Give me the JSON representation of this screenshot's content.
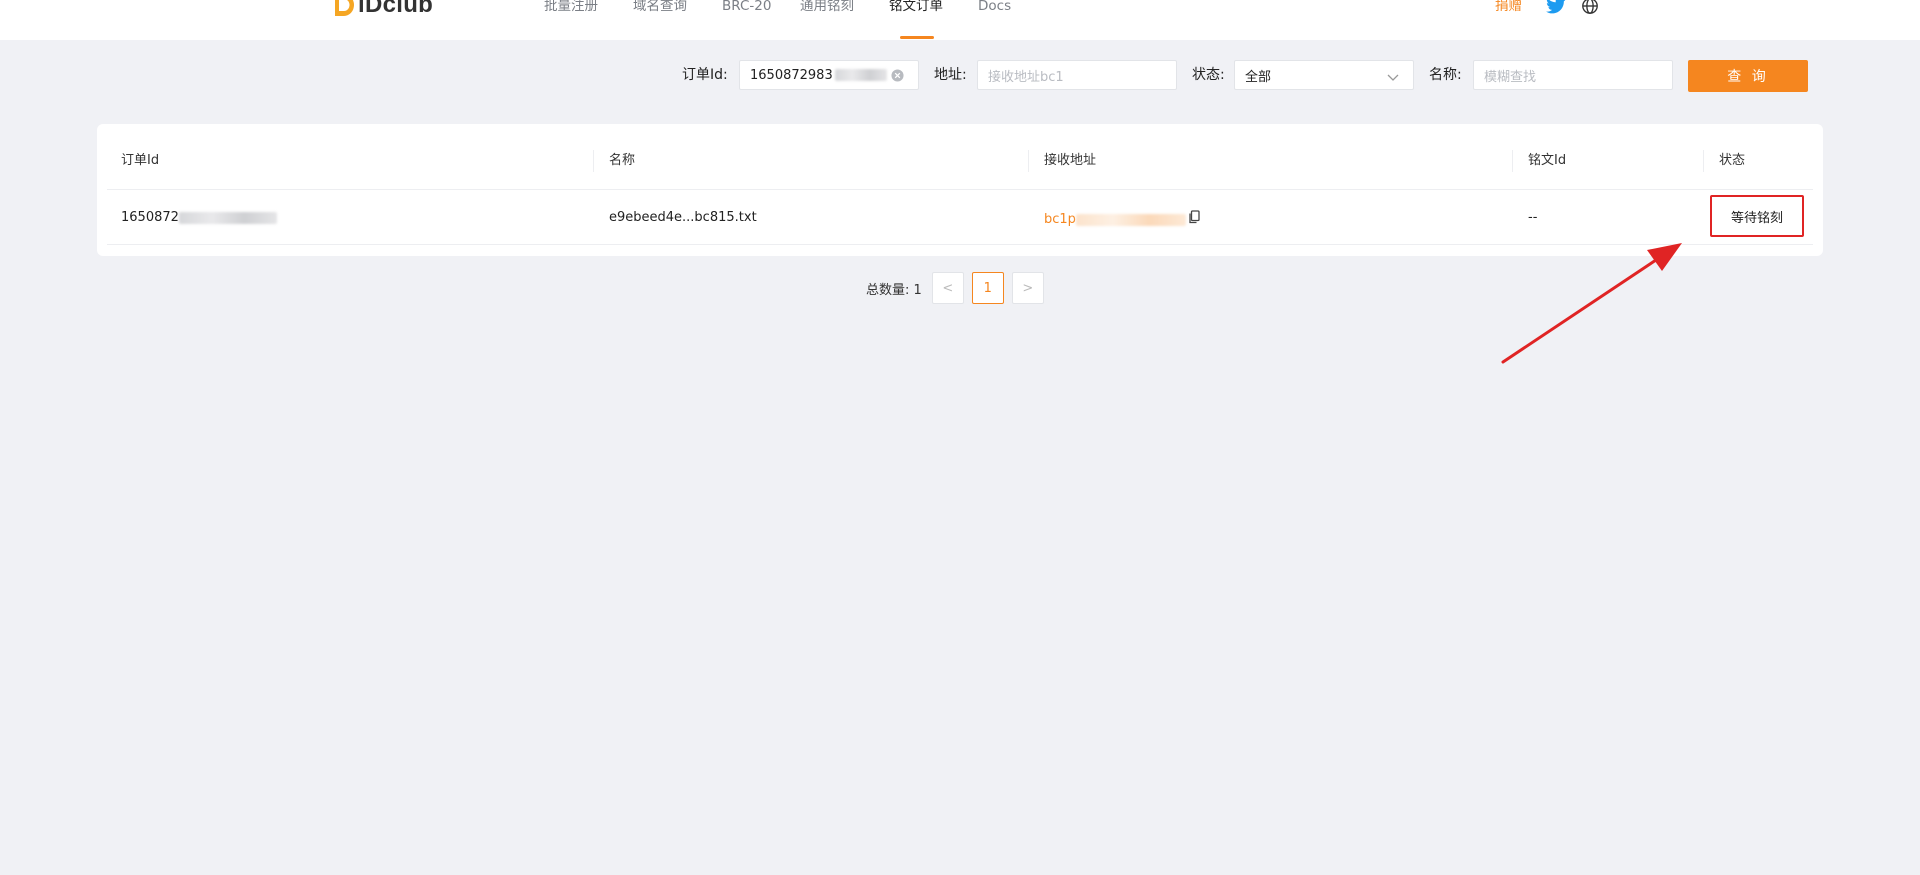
{
  "header": {
    "logo_text": "iDclub",
    "nav": [
      {
        "label": "批量注册"
      },
      {
        "label": "域名查询"
      },
      {
        "label": "BRC-20"
      },
      {
        "label": "通用铭刻"
      },
      {
        "label": "铭文订单",
        "active": true
      },
      {
        "label": "Docs"
      }
    ],
    "donate_label": "捐赠",
    "icons": [
      "twitter-icon",
      "globe-icon"
    ]
  },
  "filters": {
    "order_id_label": "订单Id:",
    "order_id_value": "1650872983",
    "address_label": "地址:",
    "address_placeholder": "接收地址bc1",
    "status_label": "状态:",
    "status_value": "全部",
    "name_label": "名称:",
    "name_placeholder": "模糊查找",
    "query_button": "查 询"
  },
  "table": {
    "columns": [
      "订单Id",
      "名称",
      "接收地址",
      "铭文Id",
      "状态"
    ],
    "rows": [
      {
        "order_id": "1650872",
        "name": "e9ebeed4e...bc815.txt",
        "address": "bc1p",
        "inscription_id": "--",
        "status": "等待铭刻"
      }
    ]
  },
  "pagination": {
    "total_label": "总数量: 1",
    "prev": "<",
    "current_page": "1",
    "next": ">"
  },
  "colors": {
    "accent": "#f5861f",
    "annotation": "#e02424",
    "background": "#f0f1f5"
  }
}
